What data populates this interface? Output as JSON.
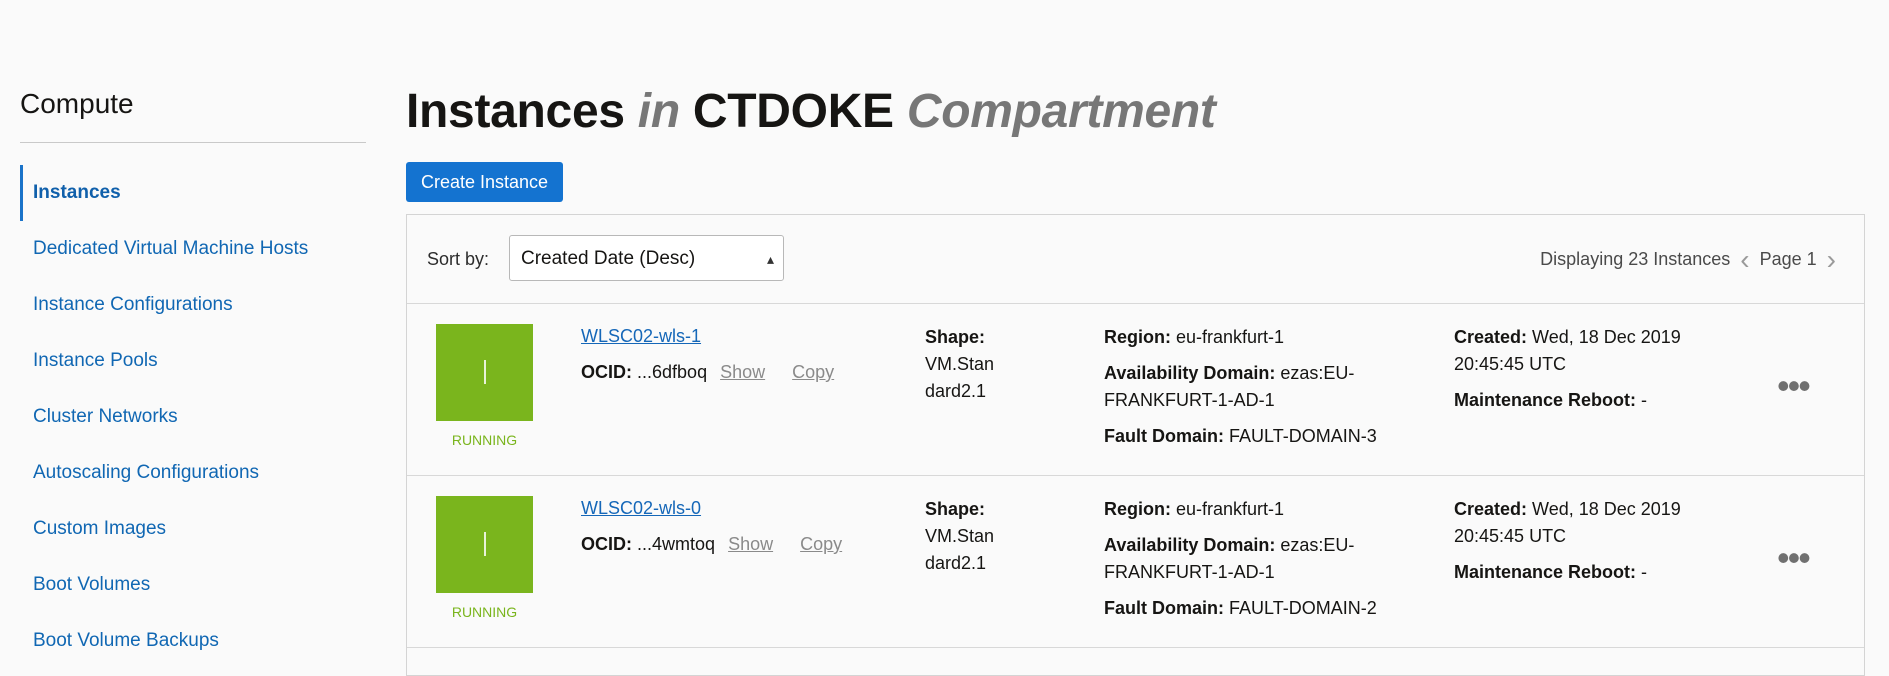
{
  "sidebar": {
    "title": "Compute",
    "items": [
      {
        "label": "Instances"
      },
      {
        "label": "Dedicated Virtual Machine Hosts"
      },
      {
        "label": "Instance Configurations"
      },
      {
        "label": "Instance Pools"
      },
      {
        "label": "Cluster Networks"
      },
      {
        "label": "Autoscaling Configurations"
      },
      {
        "label": "Custom Images"
      },
      {
        "label": "Boot Volumes"
      },
      {
        "label": "Boot Volume Backups"
      }
    ]
  },
  "header": {
    "title_part1": "Instances",
    "title_in": "in",
    "title_compartment": "CTDOKE",
    "title_suffix": "Compartment",
    "create_label": "Create Instance"
  },
  "toolbar": {
    "sort_label": "Sort by:",
    "sort_value": "Created Date (Desc)",
    "displaying": "Displaying 23 Instances",
    "page": "Page 1"
  },
  "labels": {
    "ocid": "OCID:",
    "show": "Show",
    "copy": "Copy",
    "shape": "Shape:",
    "region": "Region:",
    "availability_domain": "Availability Domain:",
    "fault_domain": "Fault Domain:",
    "created": "Created:",
    "maintenance": "Maintenance Reboot:"
  },
  "instances": [
    {
      "name": "WLSC02-wls-1",
      "status": "RUNNING",
      "ocid": "...6dfboq",
      "shape_line1": "VM.Stan",
      "shape_line2": "dard2.1",
      "region": "eu-frankfurt-1",
      "ad_line1": "ezas:EU-",
      "ad_line2": "FRANKFURT-1-AD-1",
      "fault_domain": "FAULT-DOMAIN-3",
      "created_line1": "Wed, 18 Dec 2019",
      "created_line2": "20:45:45 UTC",
      "maintenance": "-"
    },
    {
      "name": "WLSC02-wls-0",
      "status": "RUNNING",
      "ocid": "...4wmtoq",
      "shape_line1": "VM.Stan",
      "shape_line2": "dard2.1",
      "region": "eu-frankfurt-1",
      "ad_line1": "ezas:EU-",
      "ad_line2": "FRANKFURT-1-AD-1",
      "fault_domain": "FAULT-DOMAIN-2",
      "created_line1": "Wed, 18 Dec 2019",
      "created_line2": "20:45:45 UTC",
      "maintenance": "-"
    }
  ],
  "colors": {
    "accent": "#1473d0",
    "running": "#7ab51d",
    "link": "#1567b8"
  }
}
